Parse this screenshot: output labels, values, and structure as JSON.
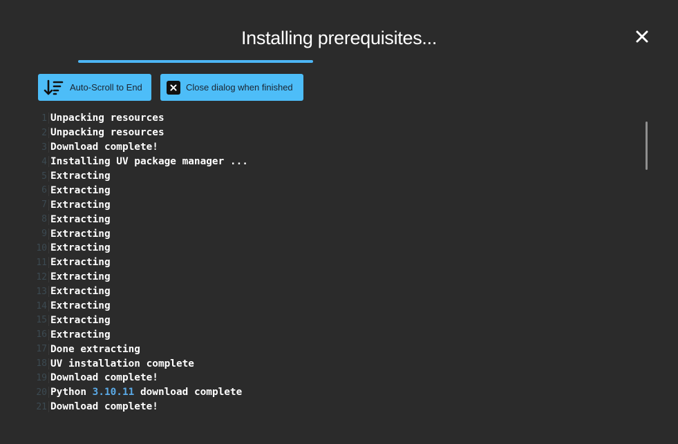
{
  "dialog": {
    "title": "Installing prerequisites...",
    "progress_percent": 35
  },
  "toolbar": {
    "autoscroll_label": "Auto-Scroll to End",
    "close_when_finished_label": "Close dialog when finished"
  },
  "colors": {
    "accent": "#4dbdf8",
    "background": "#2b2b2b",
    "number": "#5aa9e6"
  },
  "log": {
    "lines": [
      {
        "n": "1",
        "text": "Unpacking resources"
      },
      {
        "n": "2",
        "text": "Unpacking resources"
      },
      {
        "n": "3",
        "text": "Download complete!"
      },
      {
        "n": "4",
        "text": "Installing UV package manager ..."
      },
      {
        "n": "5",
        "text": "Extracting"
      },
      {
        "n": "6",
        "text": "Extracting"
      },
      {
        "n": "7",
        "text": "Extracting"
      },
      {
        "n": "8",
        "text": "Extracting"
      },
      {
        "n": "9",
        "text": "Extracting"
      },
      {
        "n": "10",
        "text": "Extracting"
      },
      {
        "n": "11",
        "text": "Extracting"
      },
      {
        "n": "12",
        "text": "Extracting"
      },
      {
        "n": "13",
        "text": "Extracting"
      },
      {
        "n": "14",
        "text": "Extracting"
      },
      {
        "n": "15",
        "text": "Extracting"
      },
      {
        "n": "16",
        "text": "Extracting"
      },
      {
        "n": "17",
        "text": "Done extracting"
      },
      {
        "n": "18",
        "text": "UV installation complete"
      },
      {
        "n": "19",
        "text": "Download complete!"
      },
      {
        "n": "20",
        "pre": "Python ",
        "num": "3.10.11",
        "post": " download complete"
      },
      {
        "n": "21",
        "text": "Download complete!"
      }
    ]
  }
}
